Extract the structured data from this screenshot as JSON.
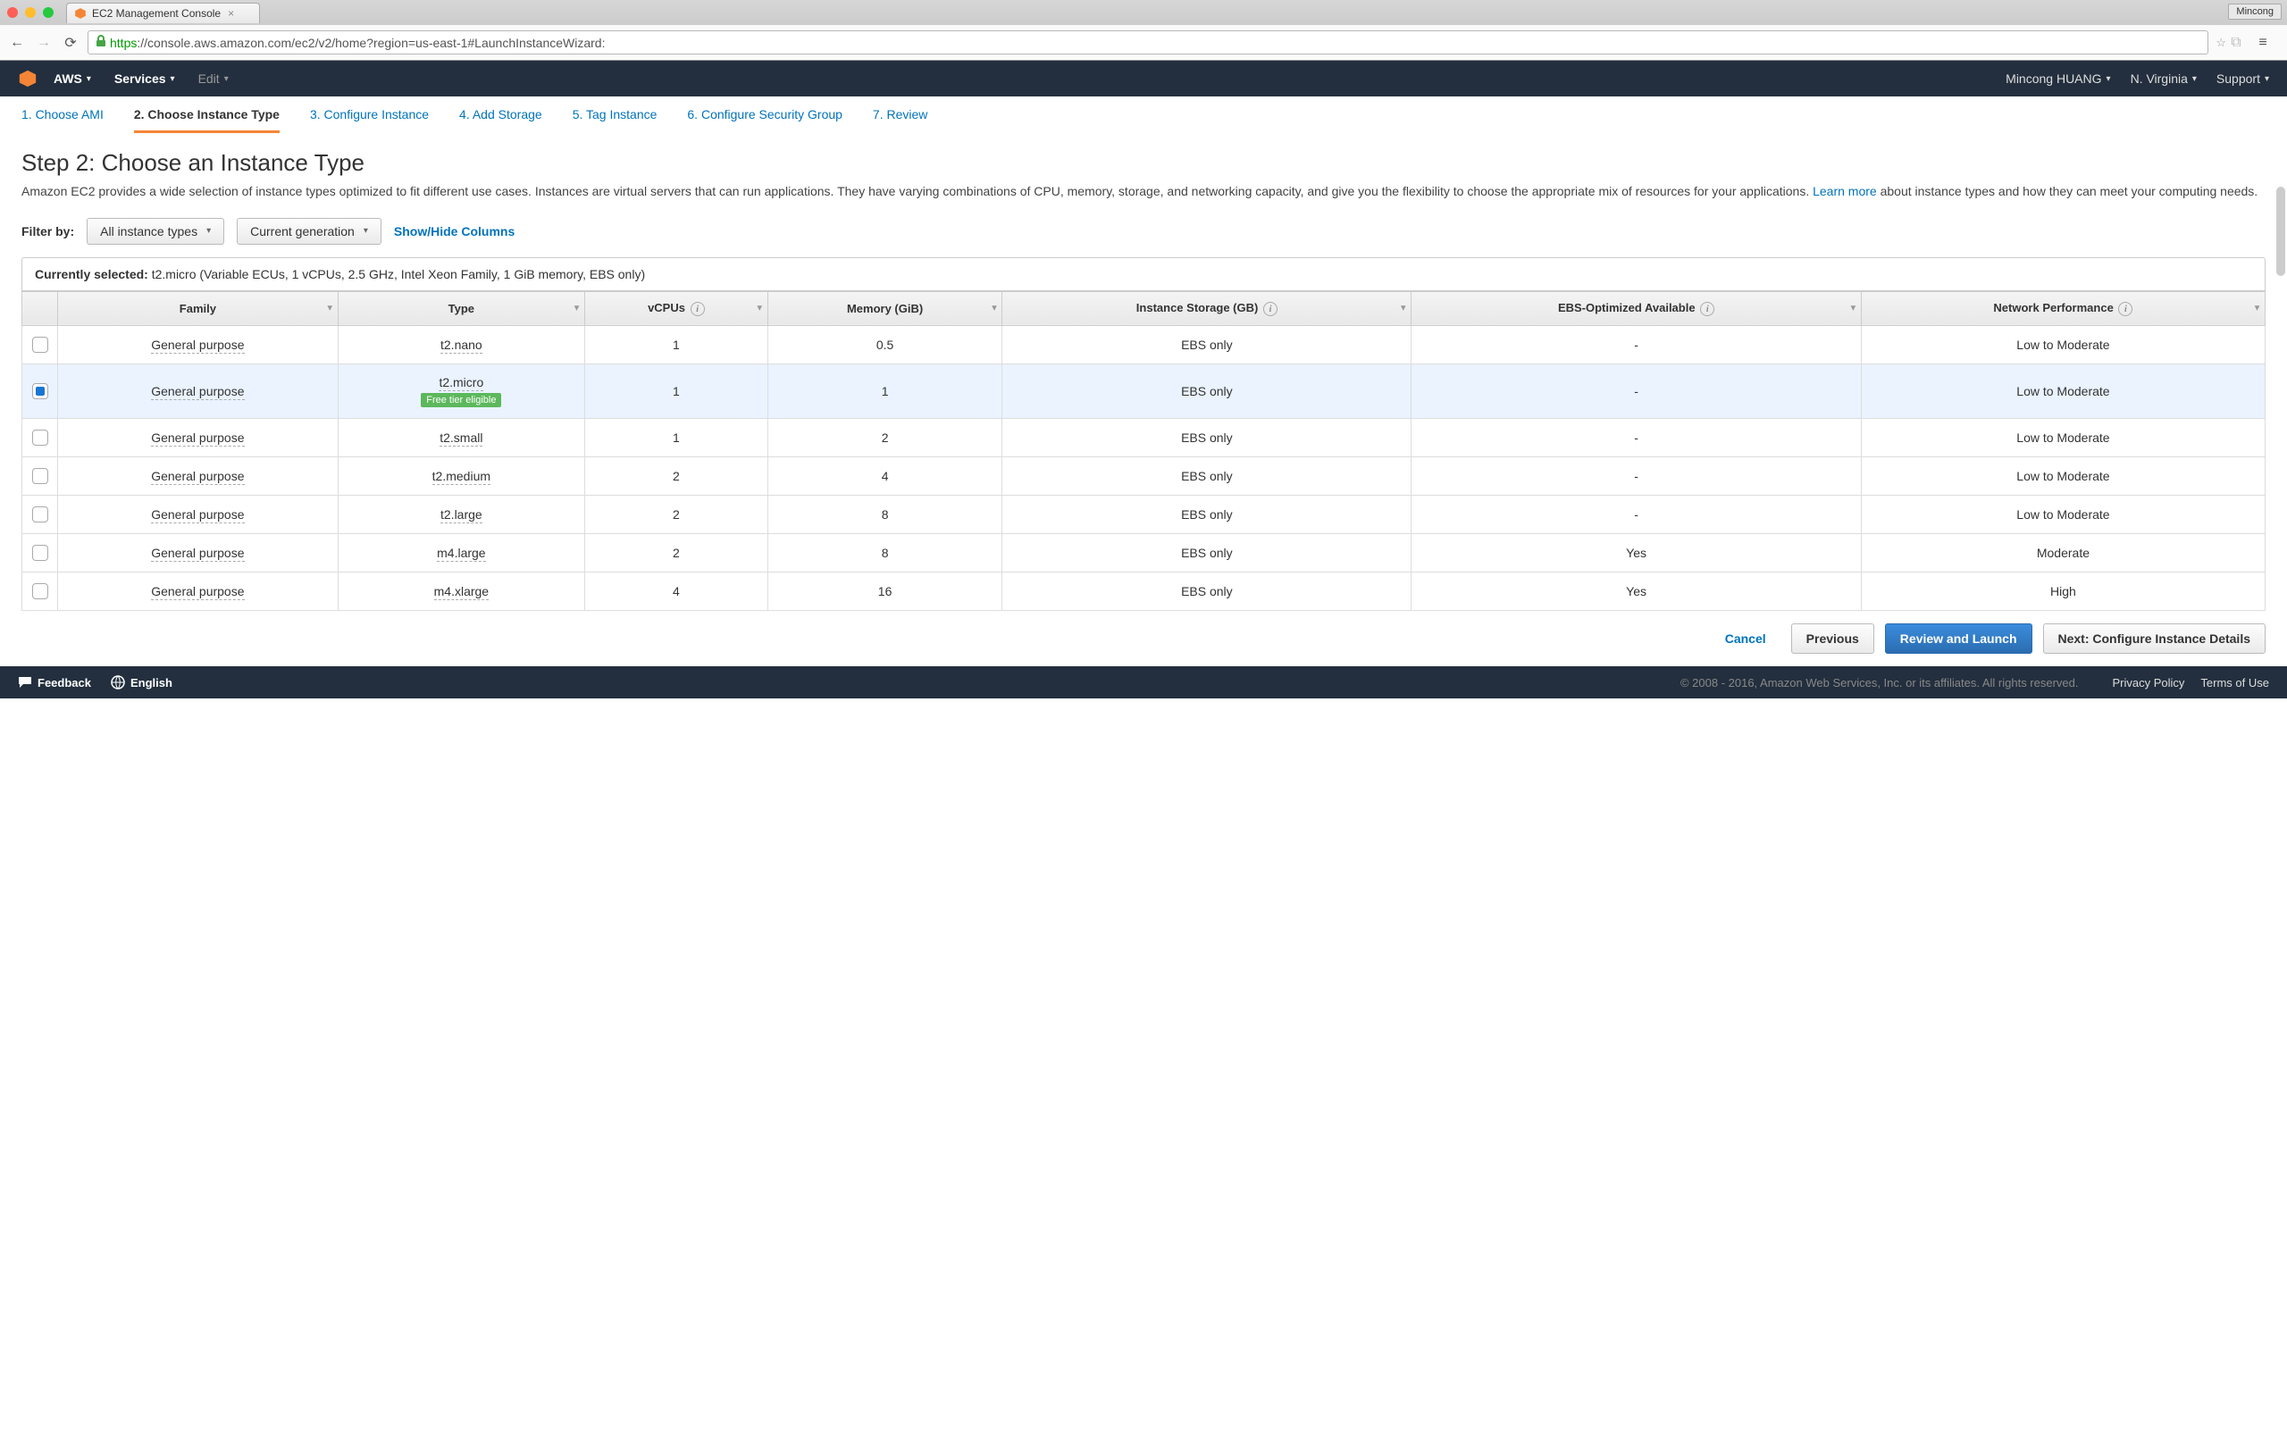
{
  "browser": {
    "tab_title": "EC2 Management Console",
    "profile": "Mincong",
    "url_https": "https",
    "url_rest": "://console.aws.amazon.com/ec2/v2/home?region=us-east-1#LaunchInstanceWizard:"
  },
  "header": {
    "aws": "AWS",
    "services": "Services",
    "edit": "Edit",
    "user": "Mincong HUANG",
    "region": "N. Virginia",
    "support": "Support"
  },
  "wizard": {
    "steps": [
      "1. Choose AMI",
      "2. Choose Instance Type",
      "3. Configure Instance",
      "4. Add Storage",
      "5. Tag Instance",
      "6. Configure Security Group",
      "7. Review"
    ],
    "active_index": 1
  },
  "page": {
    "title": "Step 2: Choose an Instance Type",
    "desc_part1": "Amazon EC2 provides a wide selection of instance types optimized to fit different use cases. Instances are virtual servers that can run applications. They have varying combinations of CPU, memory, storage, and networking capacity, and give you the flexibility to choose the appropriate mix of resources for your applications. ",
    "learn_more": "Learn more",
    "desc_part2": " about instance types and how they can meet your computing needs."
  },
  "filter": {
    "label": "Filter by:",
    "all_types": "All instance types",
    "current_gen": "Current generation",
    "show_hide": "Show/Hide Columns"
  },
  "selected_bar": {
    "label": "Currently selected:",
    "value": "t2.micro (Variable ECUs, 1 vCPUs, 2.5 GHz, Intel Xeon Family, 1 GiB memory, EBS only)"
  },
  "columns": [
    "Family",
    "Type",
    "vCPUs",
    "Memory (GiB)",
    "Instance Storage (GB)",
    "EBS-Optimized Available",
    "Network Performance"
  ],
  "free_tier_label": "Free tier eligible",
  "rows": [
    {
      "selected": false,
      "family": "General purpose",
      "type": "t2.nano",
      "free_tier": false,
      "vcpus": "1",
      "memory": "0.5",
      "storage": "EBS only",
      "ebs_opt": "-",
      "network": "Low to Moderate"
    },
    {
      "selected": true,
      "family": "General purpose",
      "type": "t2.micro",
      "free_tier": true,
      "vcpus": "1",
      "memory": "1",
      "storage": "EBS only",
      "ebs_opt": "-",
      "network": "Low to Moderate"
    },
    {
      "selected": false,
      "family": "General purpose",
      "type": "t2.small",
      "free_tier": false,
      "vcpus": "1",
      "memory": "2",
      "storage": "EBS only",
      "ebs_opt": "-",
      "network": "Low to Moderate"
    },
    {
      "selected": false,
      "family": "General purpose",
      "type": "t2.medium",
      "free_tier": false,
      "vcpus": "2",
      "memory": "4",
      "storage": "EBS only",
      "ebs_opt": "-",
      "network": "Low to Moderate"
    },
    {
      "selected": false,
      "family": "General purpose",
      "type": "t2.large",
      "free_tier": false,
      "vcpus": "2",
      "memory": "8",
      "storage": "EBS only",
      "ebs_opt": "-",
      "network": "Low to Moderate"
    },
    {
      "selected": false,
      "family": "General purpose",
      "type": "m4.large",
      "free_tier": false,
      "vcpus": "2",
      "memory": "8",
      "storage": "EBS only",
      "ebs_opt": "Yes",
      "network": "Moderate"
    },
    {
      "selected": false,
      "family": "General purpose",
      "type": "m4.xlarge",
      "free_tier": false,
      "vcpus": "4",
      "memory": "16",
      "storage": "EBS only",
      "ebs_opt": "Yes",
      "network": "High"
    }
  ],
  "actions": {
    "cancel": "Cancel",
    "previous": "Previous",
    "review": "Review and Launch",
    "next": "Next: Configure Instance Details"
  },
  "footer": {
    "feedback": "Feedback",
    "language": "English",
    "copyright": "© 2008 - 2016, Amazon Web Services, Inc. or its affiliates. All rights reserved.",
    "privacy": "Privacy Policy",
    "terms": "Terms of Use"
  }
}
